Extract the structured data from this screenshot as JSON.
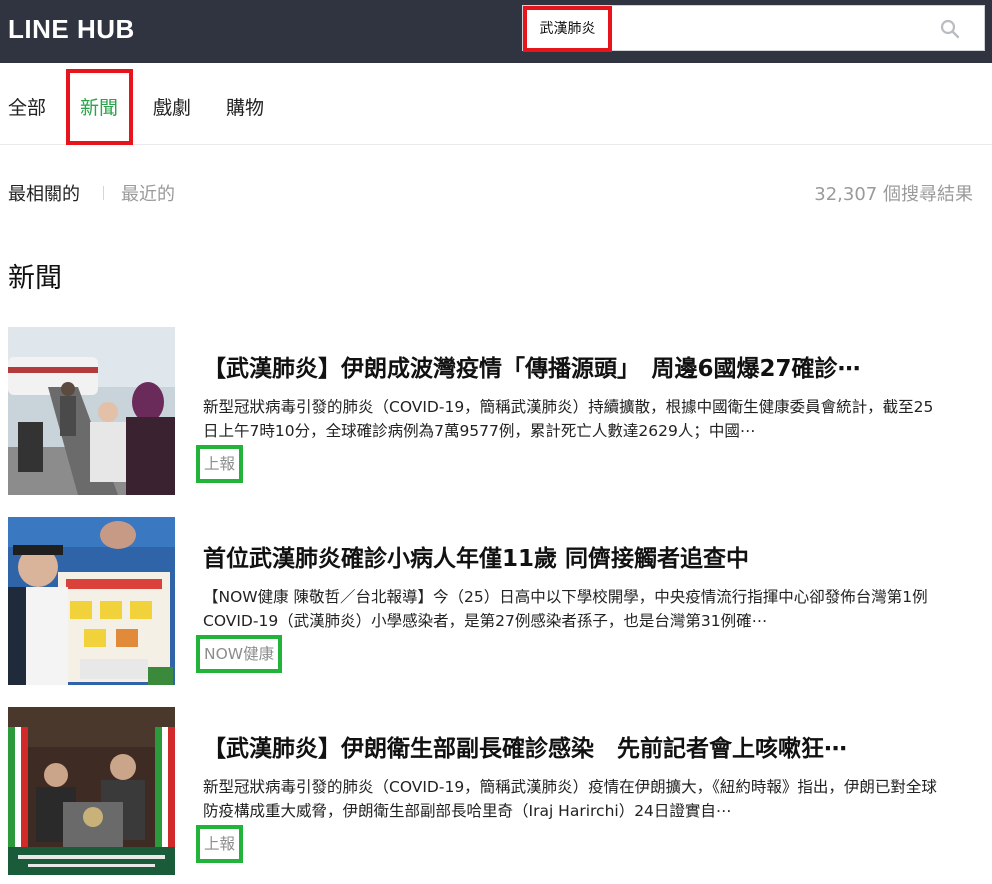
{
  "header": {
    "logo": "LINE HUB",
    "search": {
      "query": "武漢肺炎",
      "placeholder": ""
    }
  },
  "tabs": [
    {
      "label": "全部",
      "active": false
    },
    {
      "label": "新聞",
      "active": true
    },
    {
      "label": "戲劇",
      "active": false
    },
    {
      "label": "購物",
      "active": false
    }
  ],
  "sort": {
    "relevant": "最相關的",
    "recent": "最近的",
    "result_count": "32,307 個搜尋結果"
  },
  "section_title": "新聞",
  "news": [
    {
      "title": "【武漢肺炎】伊朗成波灣疫情「傳播源頭」　周邊6國爆27確診⋯",
      "desc": "新型冠狀病毒引發的肺炎（COVID-19，簡稱武漢肺炎）持續擴散，根據中國衛生健康委員會統計，截至25日上午7時10分，全球確診病例為7萬9577例，累計死亡人數達2629人；中國⋯",
      "source": "上報"
    },
    {
      "title": "首位武漢肺炎確診小病人年僅11歲 同儕接觸者追查中",
      "desc": "【NOW健康 陳敬哲／台北報導】今（25）日高中以下學校開學，中央疫情流行指揮中心卻發佈台灣第1例COVID-19（武漢肺炎）小學感染者，是第27例感染者孫子，也是台灣第31例確⋯",
      "source": "NOW健康"
    },
    {
      "title": "【武漢肺炎】伊朗衛生部副長確診感染　先前記者會上咳嗽狂⋯",
      "desc": "新型冠狀病毒引發的肺炎（COVID-19，簡稱武漢肺炎）疫情在伊朗擴大，《紐約時報》指出，伊朗已對全球防疫構成重大威脅，伊朗衛生部副部長哈里奇（Iraj Harirchi）24日證實自⋯",
      "source": "上報"
    }
  ],
  "colors": {
    "topbar": "#2f3440",
    "active_tab": "#2aa34a",
    "highlight_red": "#e8141c",
    "highlight_green": "#22b33a",
    "muted": "#9a9a9a"
  }
}
